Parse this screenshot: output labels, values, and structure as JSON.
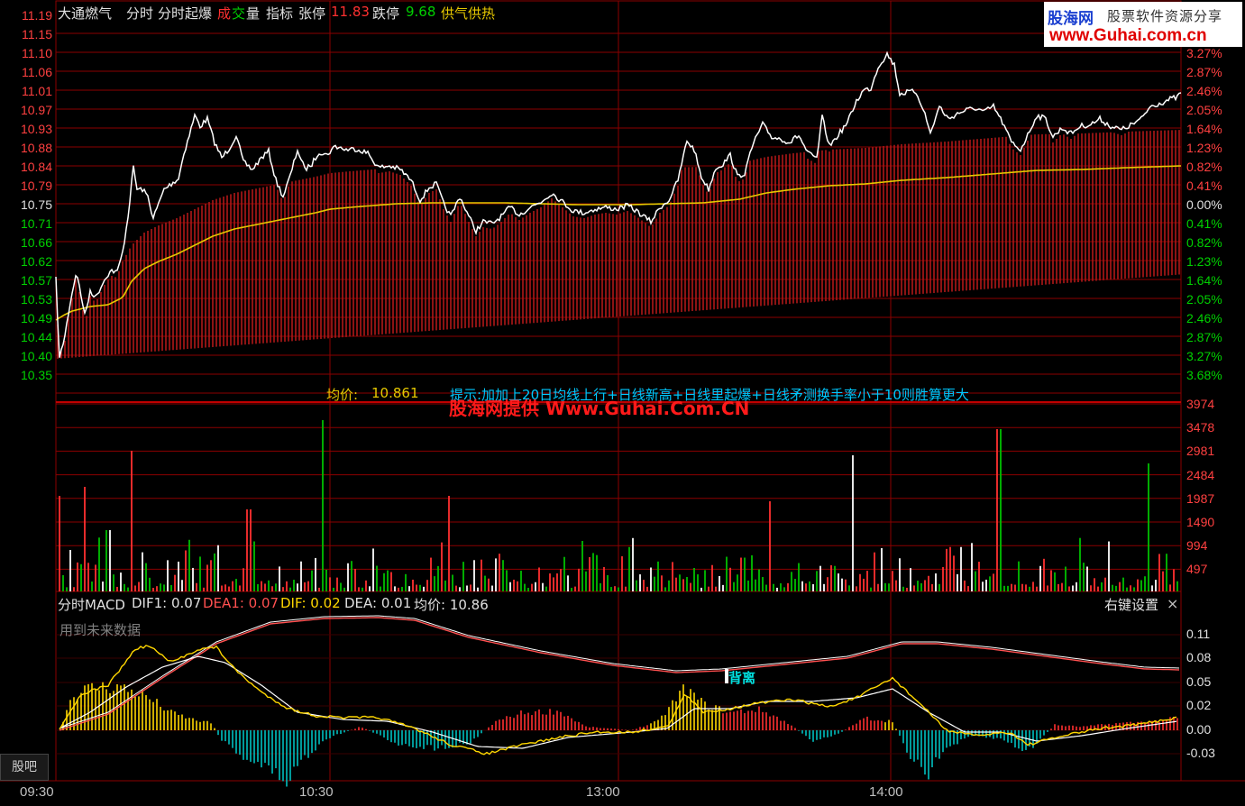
{
  "toolbar": {
    "stock_name": "大通燃气",
    "tab_intraday": "分时",
    "tab_indicator_name": "分时起爆",
    "vol_label_1": "成",
    "vol_label_2": "交",
    "vol_label_3": "量",
    "indicator": "指标",
    "limit_up_label": "张停",
    "limit_up_value": "11.83",
    "limit_down_label": "跌停",
    "limit_down_value": "9.68",
    "supply_label": "供气供热"
  },
  "logo": {
    "name": "股海网",
    "slogan": "股票软件资源分享",
    "url": "www.Guhai.com.cn"
  },
  "price_axis": {
    "left_ticks": [
      "11.19",
      "11.15",
      "11.10",
      "11.06",
      "11.01",
      "10.97",
      "10.93",
      "10.88",
      "10.84",
      "10.79",
      "10.75",
      "10.71",
      "10.66",
      "10.62",
      "10.57",
      "10.53",
      "10.49",
      "10.44",
      "10.40",
      "10.35"
    ],
    "right_ticks": [
      "",
      "",
      "3.27%",
      "2.87%",
      "2.46%",
      "2.05%",
      "1.64%",
      "1.23%",
      "0.82%",
      "0.41%",
      "0.00%",
      "0.41%",
      "0.82%",
      "1.23%",
      "1.64%",
      "2.05%",
      "2.46%",
      "2.87%",
      "3.27%",
      "3.68%"
    ]
  },
  "avg_price": {
    "label": "均价:",
    "value": "10.861"
  },
  "hint_text": "提示:加加上20日均线上行+日线新高+日线里起爆+日线矛测换手率小于10则胜算更大",
  "watermark": "股海网提供 Www.Guhai.Com.CN",
  "volume_axis": {
    "ticks": [
      "3974",
      "3478",
      "2981",
      "2484",
      "1987",
      "1490",
      "994",
      "497"
    ]
  },
  "macd": {
    "title": "分时MACD",
    "dif1_label": "DIF1: 0.07",
    "dea1_label": "DEA1: 0.07",
    "dif_label": "DIF: 0.02",
    "dea_label": "DEA: 0.01",
    "avg_label": "均价: 10.86",
    "future_data_note": "用到未来数据",
    "divergence_label": "背离",
    "right_click_settings": "右键设置",
    "close_symbol": "×",
    "ticks": [
      "0.11",
      "0.08",
      "0.05",
      "0.02",
      "0.00",
      "-0.03"
    ]
  },
  "time_axis": {
    "labels": [
      "09:30",
      "10:30",
      "13:00",
      "14:00"
    ]
  },
  "guba_button": "股吧",
  "colors": {
    "background": "#000000",
    "grid": "#8b0000",
    "price_line": "#ffffff",
    "avg_line": "#e6c800",
    "up": "#ff3030",
    "down": "#00c000",
    "neutral": "#ffffff",
    "axis_up": "#ff4040",
    "axis_down": "#00d000",
    "axis_flat": "#e0e0e0",
    "hint": "#00c8ff",
    "watermark": "#ff1a1a",
    "dea1": "#ff5050",
    "dif": "#ffd700",
    "cyan": "#00c0c0"
  }
}
